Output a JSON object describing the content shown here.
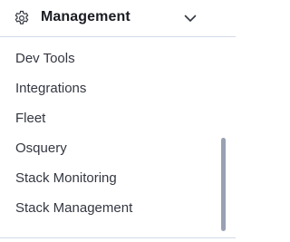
{
  "section": {
    "title": "Management",
    "icon": "gear-icon",
    "toggle_icon": "chevron-down-icon"
  },
  "items": [
    {
      "label": "Dev Tools"
    },
    {
      "label": "Integrations"
    },
    {
      "label": "Fleet"
    },
    {
      "label": "Osquery"
    },
    {
      "label": "Stack Monitoring"
    },
    {
      "label": "Stack Management"
    }
  ],
  "colors": {
    "text": "#343741",
    "title": "#1a1c21",
    "scrollbar": "#98a2b3",
    "divider": "#d3dae6"
  }
}
